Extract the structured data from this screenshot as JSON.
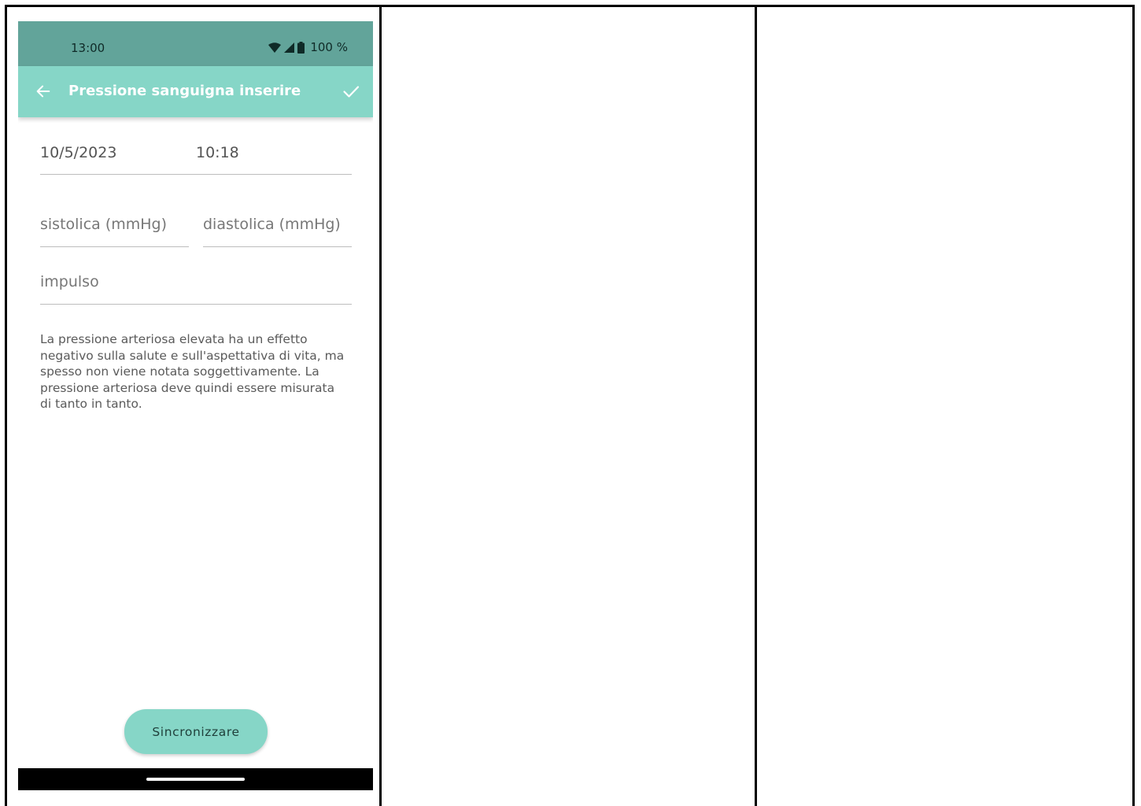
{
  "status_bar": {
    "time": "13:00",
    "battery_text": "100 %",
    "icons": [
      "wifi-icon",
      "cell-signal-icon",
      "battery-icon"
    ]
  },
  "app_bar": {
    "title": "Pressione sanguigna inserire",
    "back_icon": "arrow-left-icon",
    "confirm_icon": "check-icon"
  },
  "form": {
    "date": "10/5/2023",
    "time": "10:18",
    "systolic_placeholder": "sistolica (mmHg)",
    "diastolic_placeholder": "diastolica (mmHg)",
    "pulse_placeholder": "impulso",
    "info": "La pressione arteriosa elevata ha un effetto negativo sulla salute e sull'aspettativa di vita, ma spesso non viene notata soggettivamente. La pressione arteriosa deve quindi essere misurata di tanto in tanto."
  },
  "sync_button": {
    "label": "Sincronizzare"
  },
  "colors": {
    "status_bar": "#62a49a",
    "app_bar": "#86d6c7",
    "button": "#86d6c7",
    "nav_bar": "#000000"
  }
}
